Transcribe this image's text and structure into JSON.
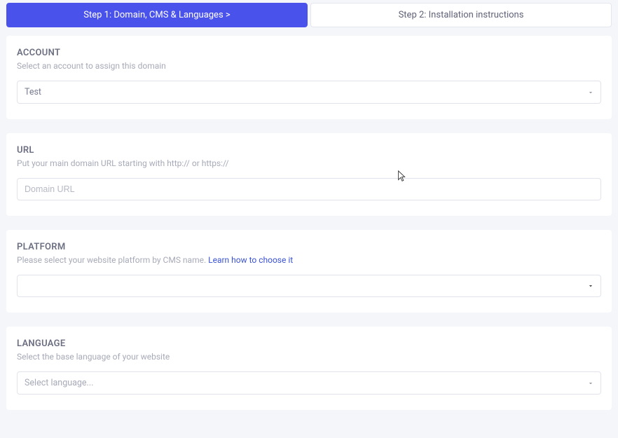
{
  "steps": {
    "step1_label": "Step 1: Domain, CMS & Languages  >",
    "step2_label": "Step 2: Installation instructions"
  },
  "account": {
    "title": "ACCOUNT",
    "subtitle": "Select an account to assign this domain",
    "selected": "Test"
  },
  "url": {
    "title": "URL",
    "subtitle": "Put your main domain URL starting with http:// or https://",
    "placeholder": "Domain URL"
  },
  "platform": {
    "title": "PLATFORM",
    "subtitle_text": "Please select your website platform by CMS name.  ",
    "subtitle_link": "Learn how to choose it",
    "selected": ""
  },
  "language": {
    "title": "LANGUAGE",
    "subtitle": "Select the base language of your website",
    "selected": "Select language..."
  }
}
